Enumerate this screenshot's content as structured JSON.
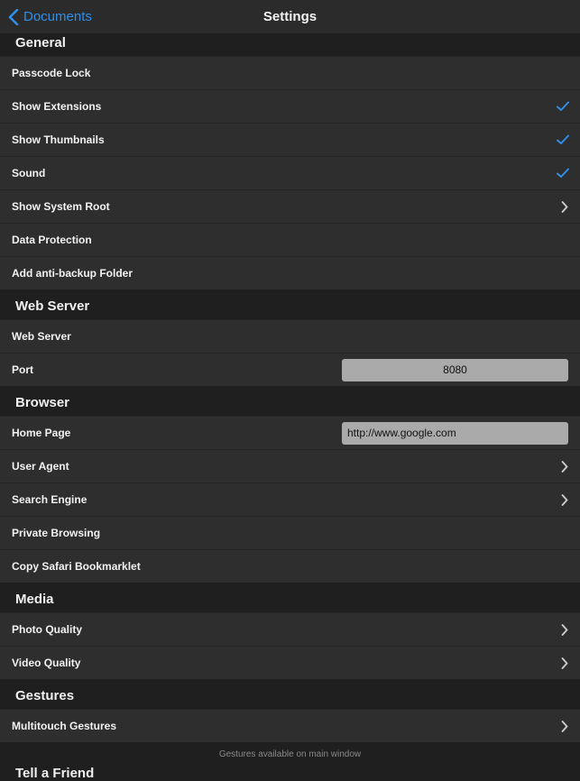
{
  "navbar": {
    "back_label": "Documents",
    "title": "Settings"
  },
  "sections": {
    "general": {
      "title": "General",
      "items": [
        {
          "label": "Passcode Lock"
        },
        {
          "label": "Show Extensions",
          "accessory": "checkmark-icon"
        },
        {
          "label": "Show Thumbnails",
          "accessory": "checkmark-icon"
        },
        {
          "label": "Sound",
          "accessory": "checkmark-icon"
        },
        {
          "label": "Show System Root",
          "accessory": "chevron-right-icon"
        },
        {
          "label": "Data Protection"
        },
        {
          "label": "Add anti-backup Folder"
        }
      ]
    },
    "web_server": {
      "title": "Web Server",
      "items": [
        {
          "label": "Web Server"
        },
        {
          "label": "Port",
          "value": "8080"
        }
      ]
    },
    "browser": {
      "title": "Browser",
      "items": [
        {
          "label": "Home Page",
          "value": "http://www.google.com"
        },
        {
          "label": "User Agent",
          "accessory": "chevron-right-icon"
        },
        {
          "label": "Search Engine",
          "accessory": "chevron-right-icon"
        },
        {
          "label": "Private Browsing"
        },
        {
          "label": "Copy Safari Bookmarklet"
        }
      ]
    },
    "media": {
      "title": "Media",
      "items": [
        {
          "label": "Photo Quality",
          "accessory": "chevron-right-icon"
        },
        {
          "label": "Video Quality",
          "accessory": "chevron-right-icon"
        }
      ]
    },
    "gestures": {
      "title": "Gestures",
      "items": [
        {
          "label": "Multitouch Gestures",
          "accessory": "chevron-right-icon"
        }
      ],
      "footer": "Gestures available on main window"
    },
    "next": {
      "title": "Tell a Friend"
    }
  },
  "colors": {
    "accent": "#2f8fe8",
    "row_bg": "#2e2e2e",
    "bg": "#1f1f1f"
  }
}
